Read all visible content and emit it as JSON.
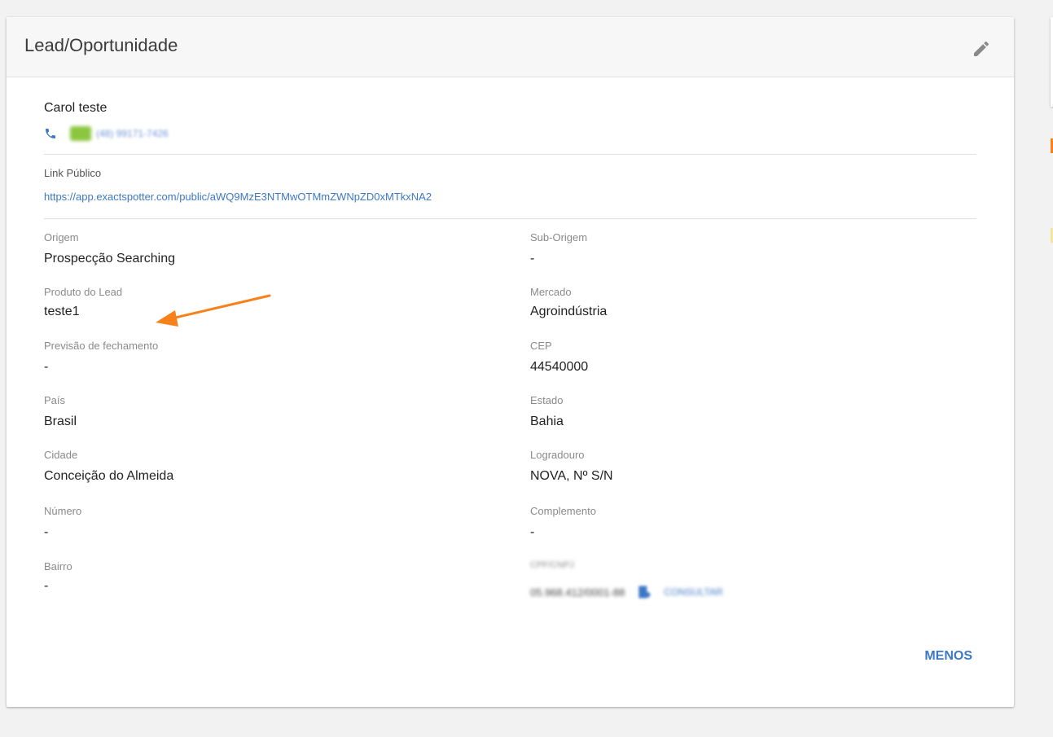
{
  "card": {
    "title": "Lead/Oportunidade",
    "edit_icon": "pencil-icon"
  },
  "contact": {
    "name": "Carol teste",
    "phone_icon": "phone-icon",
    "phone_number": "(48) 99171-7426"
  },
  "public_link": {
    "label": "Link Público",
    "url": "https://app.exactspotter.com/public/aWQ9MzE3NTMwOTMmZWNpZD0xMTkxNA2"
  },
  "fields": {
    "origem": {
      "label": "Origem",
      "value": "Prospecção Searching"
    },
    "sub_origem": {
      "label": "Sub-Origem",
      "value": "-"
    },
    "produto": {
      "label": "Produto do Lead",
      "value": "teste1"
    },
    "mercado": {
      "label": "Mercado",
      "value": "Agroindústria"
    },
    "previsao": {
      "label": "Previsão de fechamento",
      "value": "-"
    },
    "cep": {
      "label": "CEP",
      "value": "44540000"
    },
    "pais": {
      "label": "País",
      "value": "Brasil"
    },
    "estado": {
      "label": "Estado",
      "value": "Bahia"
    },
    "cidade": {
      "label": "Cidade",
      "value": "Conceição do Almeida"
    },
    "logradouro": {
      "label": "Logradouro",
      "value": "NOVA, Nº S/N"
    },
    "numero": {
      "label": "Número",
      "value": "-"
    },
    "complemento": {
      "label": "Complemento",
      "value": "-"
    },
    "bairro": {
      "label": "Bairro",
      "value": "-"
    },
    "cnpj": {
      "label": "CPF/CNPJ",
      "value": "05.968.412/0001-88",
      "consult_label": "CONSULTAR"
    }
  },
  "menos_label": "MENOS",
  "colors": {
    "accent": "#3d78c5",
    "annotation": "#f7821b",
    "whatsapp": "#8cc63f"
  }
}
